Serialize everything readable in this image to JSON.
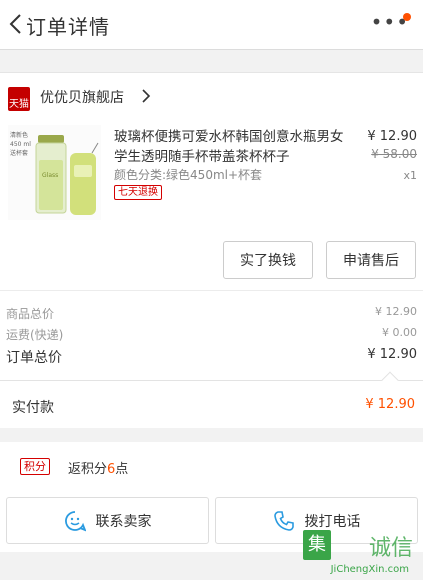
{
  "header": {
    "title": "订单详情",
    "more": "•••"
  },
  "shop": {
    "logo_text": "天猫",
    "name": "优优贝旗舰店"
  },
  "product": {
    "title": "玻璃杯便携可爱水杯韩国创意水瓶男女学生透明随手杯带盖茶杯杯子",
    "sku": "颜色分类:绿色450ml+杯套",
    "badge": "七天退换",
    "price": "¥ 12.90",
    "original_price": "¥ 58.00",
    "quantity": "x1",
    "img_text": {
      "left_lines": [
        "清新色",
        "450 ml",
        "送杯套"
      ],
      "bottle_text": "Glass"
    }
  },
  "actions": {
    "exchange": "实了换钱",
    "after_sale": "申请售后"
  },
  "summary": {
    "goods_label": "商品总价",
    "goods_value": "¥ 12.90",
    "shipping_label": "运费(快递)",
    "shipping_value": "¥ 0.00",
    "total_label": "订单总价",
    "total_value": "¥ 12.90"
  },
  "paid": {
    "label": "实付款",
    "value": "¥ 12.90"
  },
  "points": {
    "badge": "积分",
    "prefix": "返积分",
    "count": "6",
    "suffix": "点"
  },
  "contact": {
    "seller": "联系卖家",
    "call": "拨打电话"
  },
  "watermark": {
    "mark": "集",
    "text": "诚信",
    "url": "JiChengXin.com"
  },
  "colors": {
    "accent": "#ff5000",
    "tmall_red": "#c40000",
    "badge_red": "#d40000",
    "watermark_green": "#3aa548"
  }
}
